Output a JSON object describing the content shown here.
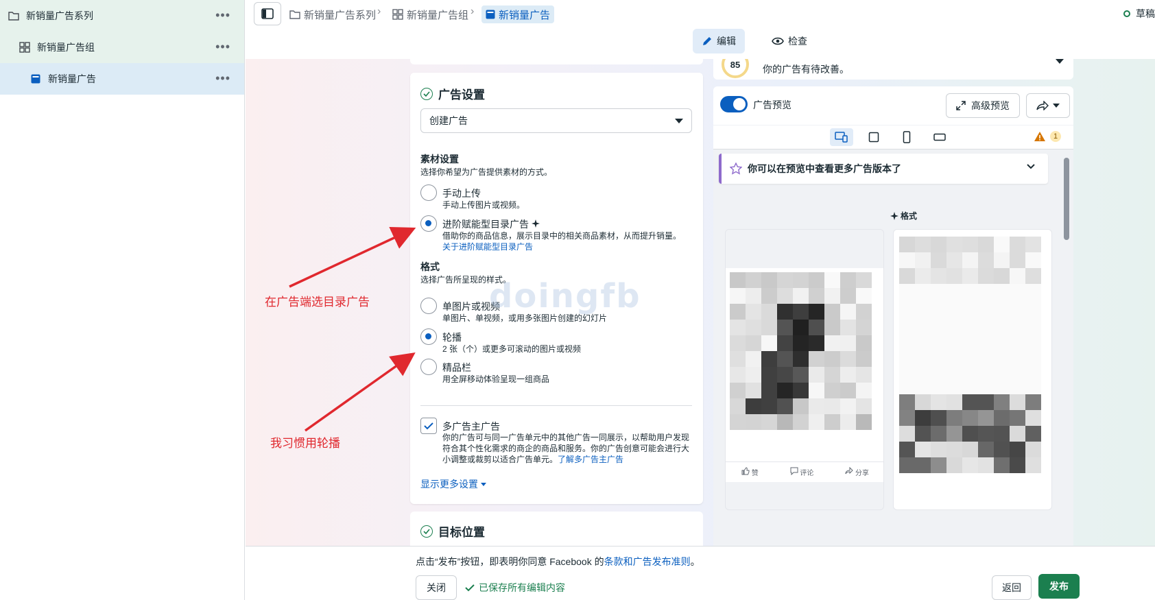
{
  "nav": {
    "campaign": "新销量广告系列",
    "adset": "新销量广告组",
    "ad": "新销量广告",
    "more": "•••"
  },
  "breadcrumb": {
    "campaign": "新销量广告系列",
    "adset": "新销量广告组",
    "ad": "新销量广告",
    "separator": "›"
  },
  "draft_status": "草稿",
  "tabs": {
    "edit": "编辑",
    "review": "检查"
  },
  "quality": {
    "score": "85",
    "desc": "你的广告有待改善。"
  },
  "ad_settings": {
    "title": "广告设置",
    "create_select": "创建广告",
    "creative_heading": "素材设置",
    "creative_desc": "选择你希望为广告提供素材的方式。",
    "manual_label": "手动上传",
    "manual_desc": "手动上传图片或视频。",
    "catalog_label": "进阶赋能型目录广告",
    "catalog_desc": "借助你的商品信息，展示目录中的相关商品素材，从而提升销量。",
    "catalog_link": "关于进阶赋能型目录广告",
    "format_heading": "格式",
    "format_desc": "选择广告所呈现的样式。",
    "single_label": "单图片或视频",
    "single_desc": "单图片、单视频，或用多张图片创建的幻灯片",
    "carousel_label": "轮播",
    "carousel_desc": "2 张（个）或更多可滚动的图片或视频",
    "collection_label": "精品栏",
    "collection_desc": "用全屏移动体验呈现一组商品",
    "multi_label": "多广告主广告",
    "multi_desc": "你的广告可与同一广告单元中的其他广告一同展示，以帮助用户发现符合其个性化需求的商企的商品和服务。你的广告创意可能会进行大小调整或裁剪以适合广告单元。",
    "multi_link": "了解多广告主广告",
    "more_settings": "显示更多设置"
  },
  "target": {
    "title": "目标位置"
  },
  "watermark": "doingfb",
  "annotations": {
    "catalog_note": "在广告端选目录广告",
    "carousel_note": "我习惯用轮播"
  },
  "preview": {
    "toggle_label": "广告预览",
    "advanced_label": "高级预览",
    "warn_count": "1",
    "more_versions": "你可以在预览中查看更多广告版本了",
    "format_tag": "格式",
    "like": "赞",
    "comment": "评论",
    "share": "分享"
  },
  "footer": {
    "consent_prefix": "点击“发布”按钮，即表明你同意 Facebook 的",
    "consent_link": "条款和广告发布准则",
    "consent_suffix": "。",
    "close": "关闭",
    "saved": "已保存所有编辑内容",
    "back": "返回",
    "publish": "发布"
  },
  "colors": {
    "brand_blue": "#0b5fbf",
    "publish_green": "#1b7f4f",
    "annotation_red": "#e0282e"
  }
}
